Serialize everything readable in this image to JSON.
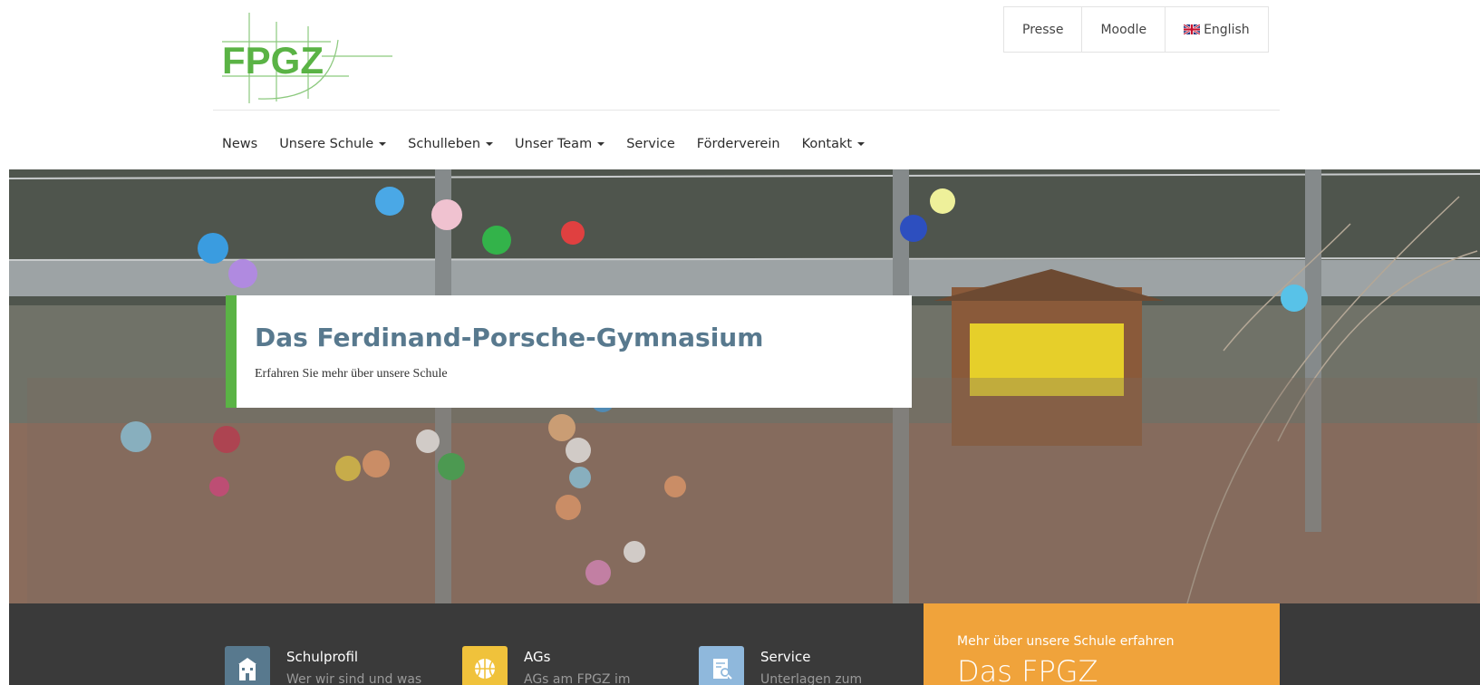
{
  "logo": {
    "text": "FPGZ",
    "color": "#5ab345"
  },
  "top_links": [
    {
      "label": "Presse"
    },
    {
      "label": "Moodle"
    },
    {
      "label": "English",
      "icon": "uk-flag-icon"
    }
  ],
  "nav": {
    "items": [
      {
        "label": "News",
        "dropdown": false
      },
      {
        "label": "Unsere Schule",
        "dropdown": true
      },
      {
        "label": "Schulleben",
        "dropdown": true
      },
      {
        "label": "Unser Team",
        "dropdown": true
      },
      {
        "label": "Service",
        "dropdown": false
      },
      {
        "label": "Förderverein",
        "dropdown": false
      },
      {
        "label": "Kontakt",
        "dropdown": true
      }
    ]
  },
  "hero": {
    "title": "Das Ferdinand-Porsche-Gymnasium",
    "subtitle": "Erfahren Sie mehr über unsere Schule",
    "accent": "#5ab345",
    "title_color": "#58798e"
  },
  "features": [
    {
      "title": "Schulprofil",
      "desc": "Wer wir sind und was",
      "icon": "school-building-icon",
      "icon_bg": "#58798e"
    },
    {
      "title": "AGs",
      "desc": "AGs am FPGZ im",
      "icon": "basketball-icon",
      "icon_bg": "#f0c23b"
    },
    {
      "title": "Service",
      "desc": "Unterlagen zum",
      "icon": "document-search-icon",
      "icon_bg": "#8fb8dc"
    }
  ],
  "promo": {
    "subtitle": "Mehr über unsere Schule erfahren",
    "title": "Das FPGZ",
    "bg": "#f0a33b"
  }
}
